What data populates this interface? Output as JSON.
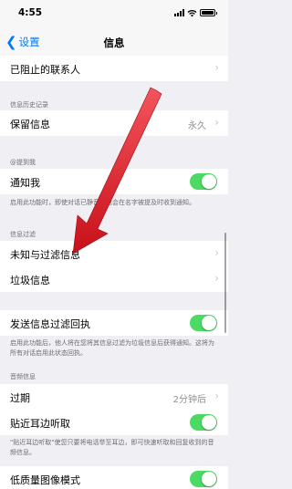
{
  "status_bar": {
    "time": "4:55"
  },
  "nav": {
    "back_label": "设置",
    "title": "信息"
  },
  "blocked": {
    "label": "已阻止的联系人"
  },
  "history": {
    "header": "信息历史记录",
    "keep_label": "保留信息",
    "keep_value": "永久"
  },
  "mention": {
    "header": "@提到我",
    "notify_label": "通知我",
    "notify_on": true,
    "footer": "启用此功能时，即使对话已静音，也会在名字被提及时收到通知。"
  },
  "filter": {
    "header": "信息过滤",
    "unknown_label": "未知与过滤信息",
    "junk_label": "垃圾信息"
  },
  "receipts": {
    "label": "发送信息过滤回执",
    "on": true,
    "footer": "启用此功能后，他人将在您将其信息过滤为垃圾信息后获得通知。这将为所有对话启用此状态回执。"
  },
  "audio": {
    "header": "音频信息",
    "expire_label": "过期",
    "expire_value": "2分钟后",
    "raise_label": "贴近耳边听取",
    "raise_on": true,
    "footer": "\"贴近耳边听取\"使您只要将电话举至耳边，即可快速听取和回复收到的音频信息。"
  },
  "low_quality": {
    "label": "低质量图像模式",
    "on": true
  },
  "colors": {
    "accent": "#007aff",
    "toggle_on": "#4cd964",
    "arrow": "#e8202a"
  }
}
